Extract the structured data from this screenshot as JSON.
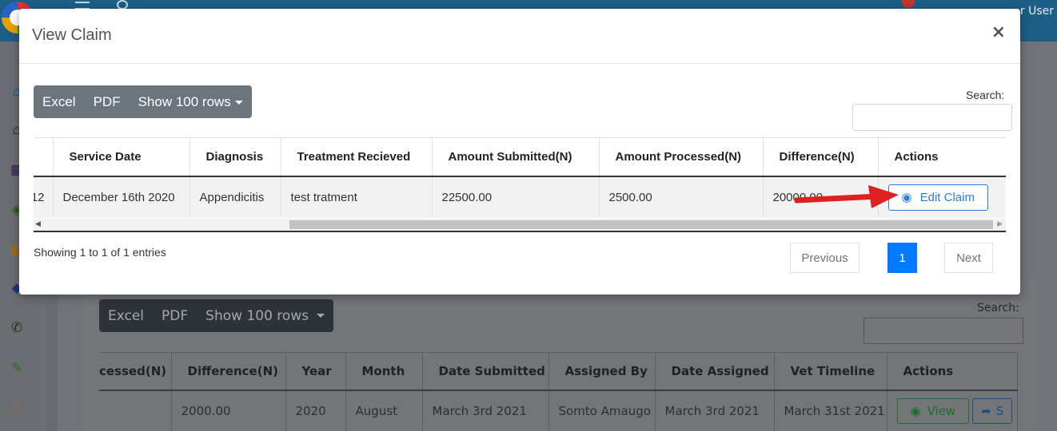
{
  "app": {
    "user_label": "r User"
  },
  "modal": {
    "title": "View Claim",
    "close_label": "×",
    "buttons": {
      "excel": "Excel",
      "pdf": "PDF",
      "show_rows": "Show 100 rows"
    },
    "search_label": "Search:",
    "search_value": "",
    "table": {
      "headers": [
        "",
        "Service Date",
        "Diagnosis",
        "Treatment Recieved",
        "Amount Submitted(N)",
        "Amount Processed(N)",
        "Difference(N)",
        "Actions"
      ],
      "rows": [
        {
          "id_partial": "12",
          "service_date": "December 16th 2020",
          "diagnosis": "Appendicitis",
          "treatment": "test tratment",
          "amount_submitted": "22500.00",
          "amount_processed": "2500.00",
          "difference": "20000.00",
          "action_label": "Edit Claim"
        }
      ]
    },
    "info": "Showing 1 to 1 of 1 entries",
    "pagination": {
      "previous": "Previous",
      "current_page": "1",
      "next": "Next"
    }
  },
  "background": {
    "buttons": {
      "excel": "Excel",
      "pdf": "PDF",
      "show_rows": "Show 100 rows"
    },
    "search_label": "Search:",
    "table": {
      "headers": [
        "cessed(N)",
        "Difference(N)",
        "Year",
        "Month",
        "Date Submitted",
        "Assigned By",
        "Date Assigned",
        "Vet Timeline",
        "Actions"
      ],
      "row": {
        "processed": "",
        "difference": "2000.00",
        "year": "2020",
        "month": "August",
        "date_submitted": "March 3rd 2021",
        "assigned_by": "Somto Amaugo",
        "date_assigned": "March 3rd 2021",
        "vet_timeline": "March 31st 2021",
        "view_label": "View",
        "share_label": "S"
      }
    }
  },
  "colors": {
    "primary": "#007bff",
    "secondary_btn": "#6c757d",
    "topbar": "#1d5e86",
    "annotation_arrow": "#e02020"
  }
}
